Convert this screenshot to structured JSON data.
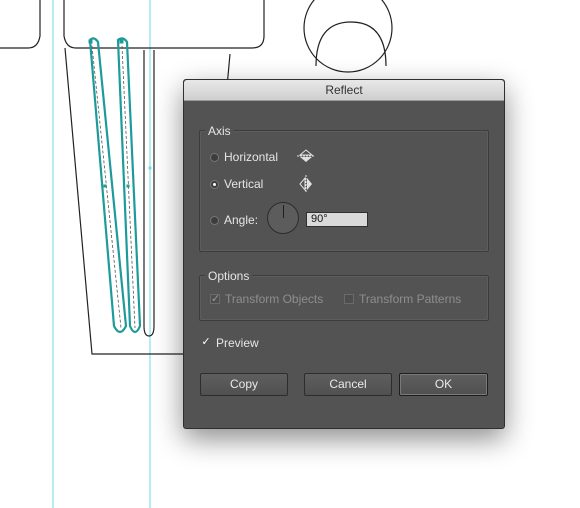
{
  "dialog": {
    "title": "Reflect",
    "axis": {
      "legend": "Axis",
      "horizontal_label": "Horizontal",
      "vertical_label": "Vertical",
      "angle_label": "Angle:",
      "angle_value": "90°",
      "selected": "Vertical"
    },
    "options": {
      "legend": "Options",
      "transform_objects_label": "Transform Objects",
      "transform_objects_checked": true,
      "transform_patterns_label": "Transform Patterns",
      "transform_patterns_checked": false
    },
    "preview": {
      "label": "Preview",
      "checked": true
    },
    "buttons": {
      "copy": "Copy",
      "cancel": "Cancel",
      "ok": "OK"
    }
  },
  "colors": {
    "guide": "#6fdbe0",
    "selection": "#1f9a9a",
    "dialog_bg": "#535353"
  }
}
